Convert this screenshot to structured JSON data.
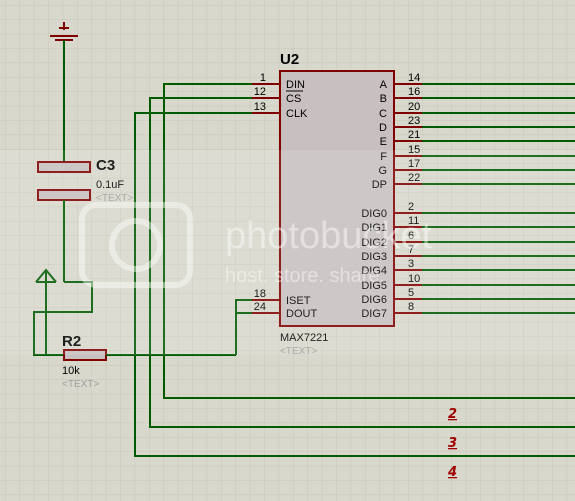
{
  "colors": {
    "background": "#d8d8cc",
    "grid": "#c6c6b8",
    "wire": "#005a00",
    "component": "#800000",
    "chip_fill": "#c8c0c0",
    "text": "#000000",
    "placeholder_text": "#a0a0a0",
    "bus_label": "#a00000"
  },
  "icons": {
    "capacitor": "capacitor-symbol",
    "resistor": "resistor-symbol",
    "ground": "ground-symbol",
    "power": "power-arrow-symbol"
  },
  "u2": {
    "ref": "U2",
    "part": "MAX7221",
    "text_placeholder": "<TEXT>",
    "left_pins": [
      {
        "num": "1",
        "name": "DIN"
      },
      {
        "num": "12",
        "name": "CS"
      },
      {
        "num": "13",
        "name": "CLK"
      },
      {
        "num": "18",
        "name": "ISET"
      },
      {
        "num": "24",
        "name": "DOUT"
      }
    ],
    "right_pins": [
      {
        "num": "14",
        "name": "A"
      },
      {
        "num": "16",
        "name": "B"
      },
      {
        "num": "20",
        "name": "C"
      },
      {
        "num": "23",
        "name": "D"
      },
      {
        "num": "21",
        "name": "E"
      },
      {
        "num": "15",
        "name": "F"
      },
      {
        "num": "17",
        "name": "G"
      },
      {
        "num": "22",
        "name": "DP"
      },
      {
        "num": "2",
        "name": "DIG0"
      },
      {
        "num": "11",
        "name": "DIG1"
      },
      {
        "num": "6",
        "name": "DIG2"
      },
      {
        "num": "7",
        "name": "DIG3"
      },
      {
        "num": "3",
        "name": "DIG4"
      },
      {
        "num": "10",
        "name": "DIG5"
      },
      {
        "num": "5",
        "name": "DIG6"
      },
      {
        "num": "8",
        "name": "DIG7"
      }
    ]
  },
  "c3": {
    "ref": "C3",
    "value": "0.1uF",
    "text_placeholder": "<TEXT>"
  },
  "r2": {
    "ref": "R2",
    "value": "10k",
    "text_placeholder": "<TEXT>"
  },
  "bus_labels": [
    "2",
    "3",
    "4"
  ],
  "watermark": {
    "line1": "photobucket",
    "line2": "host. store. share."
  }
}
